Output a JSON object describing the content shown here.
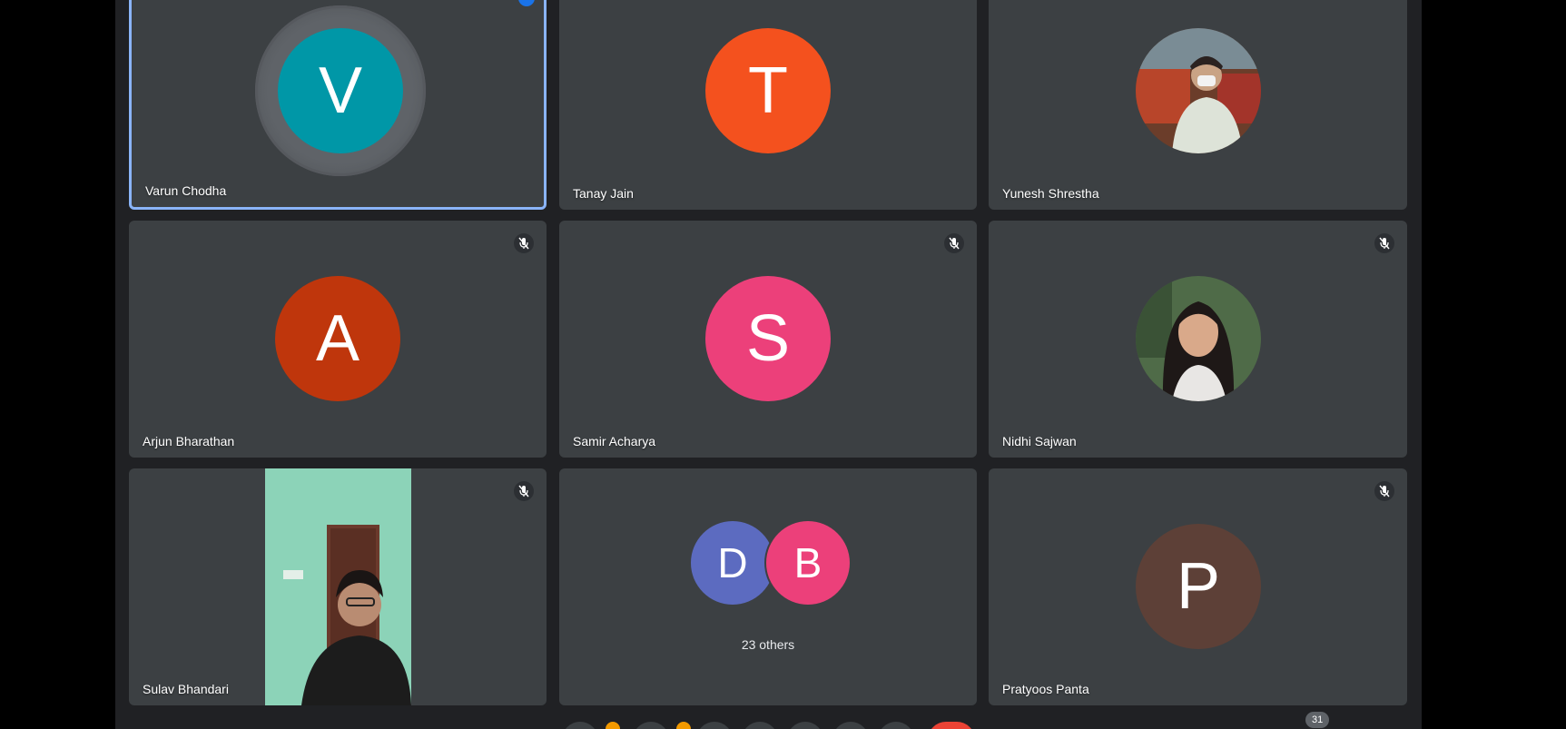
{
  "participants": [
    {
      "name": "Varun Chodha",
      "initial": "V",
      "color": "#0097a7",
      "speaking": true,
      "muted": false
    },
    {
      "name": "Tanay Jain",
      "initial": "T",
      "color": "#f4511e",
      "muted": false
    },
    {
      "name": "Yunesh Shrestha",
      "initial": "",
      "photo": true,
      "muted": false
    },
    {
      "name": "Arjun Bharathan",
      "initial": "A",
      "color": "#bf360c",
      "muted": true
    },
    {
      "name": "Samir Acharya",
      "initial": "S",
      "color": "#ec407a",
      "muted": true
    },
    {
      "name": "Nidhi Sajwan",
      "initial": "",
      "photo": true,
      "muted": true
    },
    {
      "name": "Sulav Bhandari",
      "initial": "",
      "video": true,
      "muted": true
    },
    {
      "name": "Pratyoos Panta",
      "initial": "P",
      "color": "#5d4037",
      "muted": true
    }
  ],
  "others": {
    "label": "23 others",
    "avatars": [
      {
        "initial": "D",
        "color": "#5c6bc0"
      },
      {
        "initial": "B",
        "color": "#ec407a"
      }
    ]
  },
  "participant_count": "31",
  "colors": {
    "background": "#202124",
    "tile": "#3c4043",
    "active_border": "#8ab4f8",
    "end_call": "#ea4335"
  }
}
